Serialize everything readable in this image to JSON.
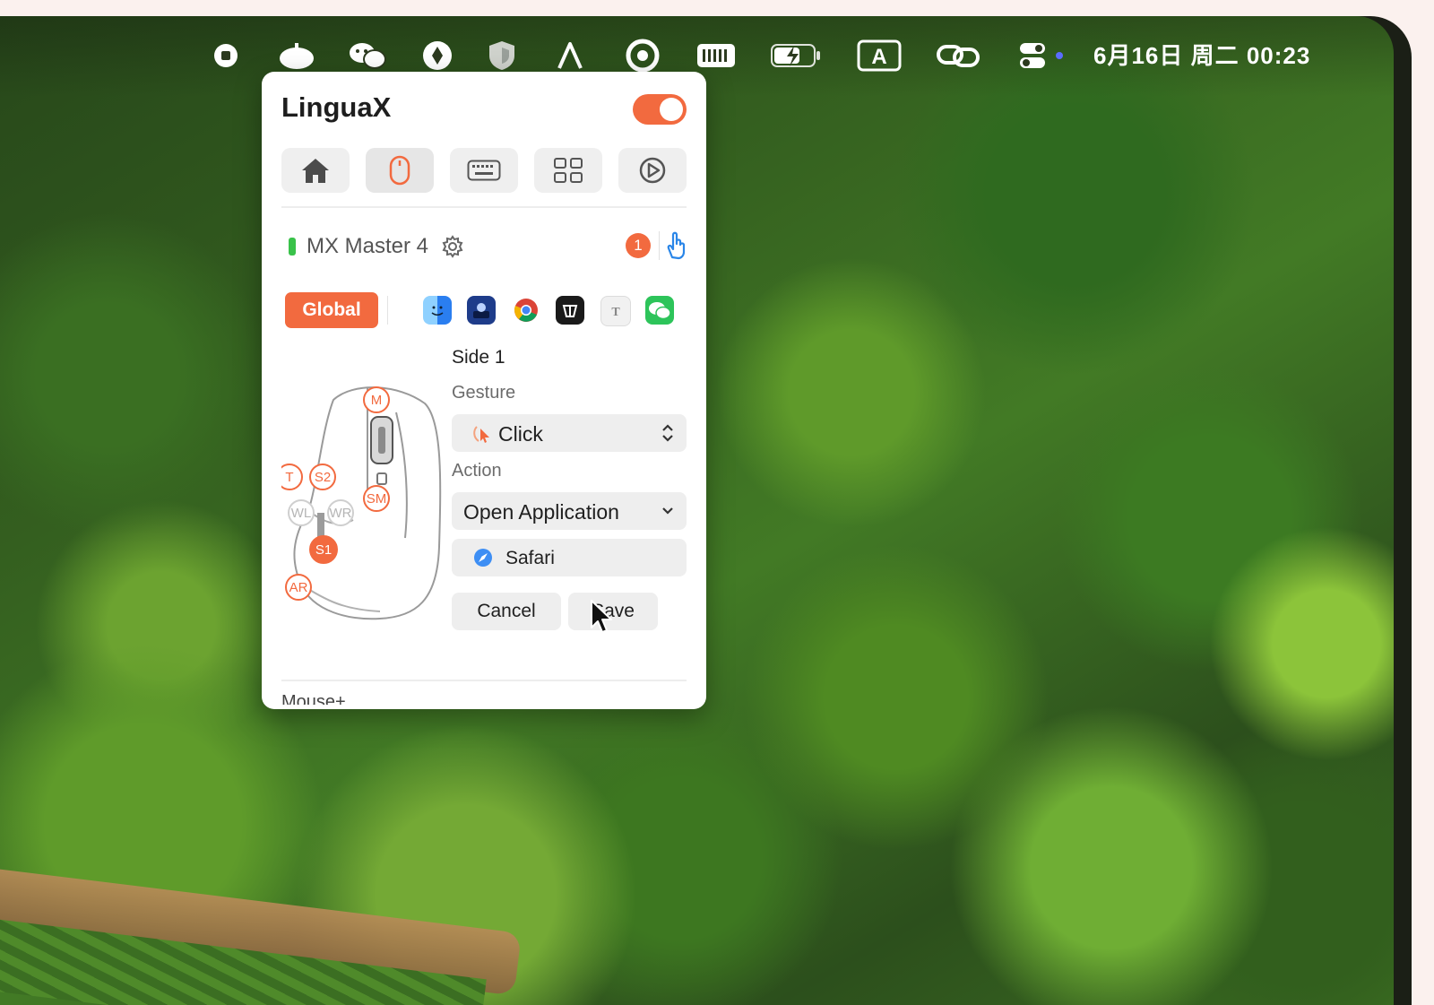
{
  "menubar": {
    "icons": [
      "record-icon",
      "fruit-icon",
      "wechat-icon",
      "eyedropper-icon",
      "shield-icon",
      "linguax-logo-icon",
      "circle-target-icon",
      "keyboard-icon",
      "battery-charging-icon",
      "input-source-icon",
      "link-icon",
      "control-center-icon"
    ],
    "input_source_letter": "A",
    "datetime": "6月16日 周二  00:23"
  },
  "panel": {
    "title": "LinguaX",
    "enabled": true,
    "tabs": [
      {
        "icon": "home-icon",
        "active": false
      },
      {
        "icon": "mouse-icon",
        "active": true
      },
      {
        "icon": "keyboard-icon",
        "active": false
      },
      {
        "icon": "grid-icon",
        "active": false
      },
      {
        "icon": "play-circle-icon",
        "active": false
      }
    ],
    "device": {
      "name": "MX Master 4",
      "badge_count": "1"
    },
    "global_label": "Global",
    "apps": [
      {
        "icon": "finder-icon",
        "color": "#3a8ef0"
      },
      {
        "icon": "app-dark-blue-icon",
        "color": "#1e3c8a"
      },
      {
        "icon": "chrome-icon",
        "color": "#ffffff"
      },
      {
        "icon": "app-black-icon",
        "color": "#1a1a1a"
      },
      {
        "icon": "typora-icon",
        "color": "#f1f1f1"
      },
      {
        "icon": "wechat-icon",
        "color": "#2dc45a"
      }
    ],
    "buttons_map": {
      "M": "M",
      "T": "T",
      "S2": "S2",
      "WL": "WL",
      "WR": "WR",
      "SM": "SM",
      "S1": "S1",
      "AR": "AR"
    },
    "selected_button": "Side 1",
    "gesture_label": "Gesture",
    "gesture_value": "Click",
    "action_label": "Action",
    "action_value": "Open Application",
    "application_value": "Safari",
    "cancel_label": "Cancel",
    "save_label": "Save",
    "next_section": "Mouse+",
    "colors": {
      "accent": "#f26a3f",
      "toggle_on": "#f26a3f",
      "battery": "#39c24a"
    }
  }
}
